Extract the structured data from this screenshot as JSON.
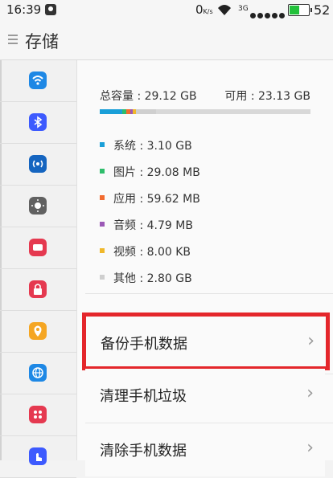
{
  "status_bar": {
    "time": "16:39",
    "net_speed": "0",
    "net_speed_unit": "K/s",
    "network_type": "3G",
    "battery_level": "52",
    "battery_text": "52",
    "battery_color": "#23c13b"
  },
  "header": {
    "title": "存储"
  },
  "sidebar": {
    "items": [
      {
        "icon": "wifi-icon",
        "color": "#1e88e5"
      },
      {
        "icon": "bluetooth-icon",
        "color": "#3d5afe"
      },
      {
        "icon": "hotspot-icon",
        "color": "#1565c0"
      },
      {
        "icon": "brightness-icon",
        "color": "#616161"
      },
      {
        "icon": "display-icon",
        "color": "#e53950"
      },
      {
        "icon": "lock-icon",
        "color": "#e53950"
      },
      {
        "icon": "location-icon",
        "color": "#f5a623"
      },
      {
        "icon": "globe-icon",
        "color": "#1e88e5"
      },
      {
        "icon": "apps-icon",
        "color": "#e53950"
      },
      {
        "icon": "gesture-icon",
        "color": "#3d5afe"
      }
    ]
  },
  "storage": {
    "total_label": "总容量 : 29.12 GB",
    "available_label": "可用 : 23.13 GB",
    "categories": [
      {
        "label": "系统 : 3.10 GB",
        "color": "#1a9fd8",
        "fraction": 0.106
      },
      {
        "label": "图片 : 29.08 MB",
        "color": "#2ebd6b",
        "fraction": 0.02
      },
      {
        "label": "应用 : 59.62 MB",
        "color": "#f26b2f",
        "fraction": 0.02
      },
      {
        "label": "音频 : 4.79 MB",
        "color": "#9b59b6",
        "fraction": 0.012
      },
      {
        "label": "视频 : 8.00 KB",
        "color": "#f0b82b",
        "fraction": 0.012
      },
      {
        "label": "其他 : 2.80 GB",
        "color": "#cfcfcf",
        "fraction": 0.096
      }
    ]
  },
  "actions": [
    {
      "label": "备份手机数据",
      "highlighted": true
    },
    {
      "label": "清理手机垃圾",
      "highlighted": false
    },
    {
      "label": "清除手机数据",
      "highlighted": false
    }
  ],
  "chevron": "›",
  "colors": {
    "highlight": "#e4262b"
  }
}
